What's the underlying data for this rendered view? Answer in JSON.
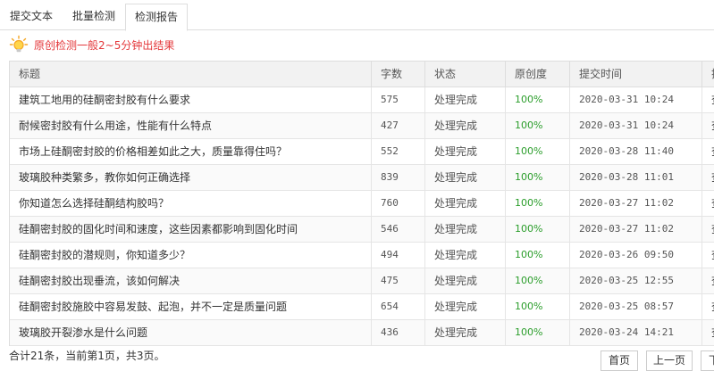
{
  "tabs": [
    {
      "label": "提交文本"
    },
    {
      "label": "批量检测"
    },
    {
      "label": "检测报告"
    }
  ],
  "notice": {
    "text": "原创检测一般2~5分钟出结果",
    "icon": "lightbulb-icon",
    "color": "#e4393c"
  },
  "table": {
    "headers": {
      "title": "标题",
      "count": "字数",
      "status": "状态",
      "originality": "原创度",
      "time": "提交时间",
      "op": "操"
    },
    "rows": [
      {
        "title": "建筑工地用的硅酮密封胶有什么要求",
        "count": "575",
        "status": "处理完成",
        "originality": "100%",
        "time": "2020-03-31 10:24",
        "op": "查"
      },
      {
        "title": "耐候密封胶有什么用途，性能有什么特点",
        "count": "427",
        "status": "处理完成",
        "originality": "100%",
        "time": "2020-03-31 10:24",
        "op": "查"
      },
      {
        "title": "市场上硅酮密封胶的价格相差如此之大，质量靠得住吗？",
        "count": "552",
        "status": "处理完成",
        "originality": "100%",
        "time": "2020-03-28 11:40",
        "op": "查"
      },
      {
        "title": "玻璃胶种类繁多，教你如何正确选择",
        "count": "839",
        "status": "处理完成",
        "originality": "100%",
        "time": "2020-03-28 11:01",
        "op": "查"
      },
      {
        "title": "你知道怎么选择硅酮结构胶吗？",
        "count": "760",
        "status": "处理完成",
        "originality": "100%",
        "time": "2020-03-27 11:02",
        "op": "查"
      },
      {
        "title": "硅酮密封胶的固化时间和速度，这些因素都影响到固化时间",
        "count": "546",
        "status": "处理完成",
        "originality": "100%",
        "time": "2020-03-27 11:02",
        "op": "查"
      },
      {
        "title": "硅酮密封胶的潜规则，你知道多少？",
        "count": "494",
        "status": "处理完成",
        "originality": "100%",
        "time": "2020-03-26 09:50",
        "op": "查"
      },
      {
        "title": "硅酮密封胶出现垂流，该如何解决",
        "count": "475",
        "status": "处理完成",
        "originality": "100%",
        "time": "2020-03-25 12:55",
        "op": "查"
      },
      {
        "title": "硅酮密封胶施胶中容易发鼓、起泡，并不一定是质量问题",
        "count": "654",
        "status": "处理完成",
        "originality": "100%",
        "time": "2020-03-25 08:57",
        "op": "查"
      },
      {
        "title": "玻璃胶开裂渗水是什么问题",
        "count": "436",
        "status": "处理完成",
        "originality": "100%",
        "time": "2020-03-24 14:21",
        "op": "查"
      }
    ]
  },
  "footer": {
    "summary": "合计21条，当前第1页，共3页。",
    "first": "首页",
    "prev": "上一页",
    "next": "下"
  }
}
